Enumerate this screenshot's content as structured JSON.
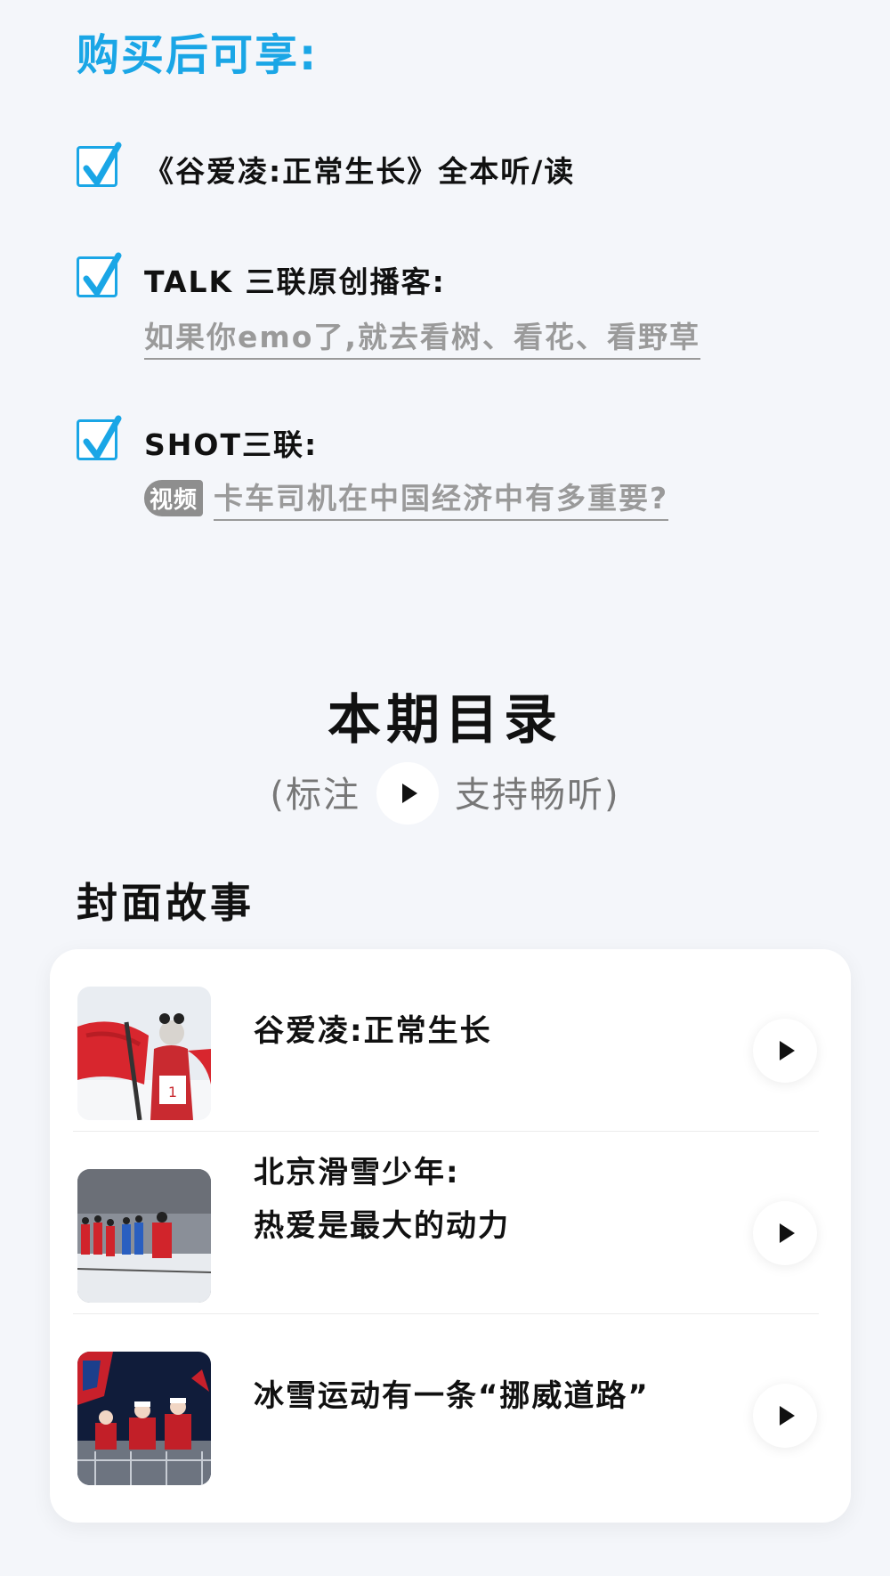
{
  "benefits": {
    "title": "购买后可享:",
    "items": [
      {
        "text": "《谷爱凌:正常生长》全本听/读"
      },
      {
        "text": "TALK 三联原创播客:",
        "sub": "如果你emo了,就去看树、看花、看野草"
      },
      {
        "text": "SHOT三联:",
        "tag": "视频",
        "sub": "卡车司机在中国经济中有多重要?"
      }
    ]
  },
  "toc": {
    "title": "本期目录",
    "hint_before": "(标注",
    "hint_after": "支持畅听)"
  },
  "section": {
    "title": "封面故事",
    "articles": [
      {
        "title": "谷爱凌:正常生长"
      },
      {
        "title_line1": "北京滑雪少年:",
        "title_line2": "热爱是最大的动力"
      },
      {
        "title": "冰雪运动有一条“挪威道路”"
      }
    ]
  },
  "colors": {
    "accent": "#1aa6e6",
    "background": "#f4f6fa",
    "muted": "#9a9a9a"
  },
  "icons": {
    "check": "checkbox-checked-icon",
    "play": "play-icon"
  }
}
